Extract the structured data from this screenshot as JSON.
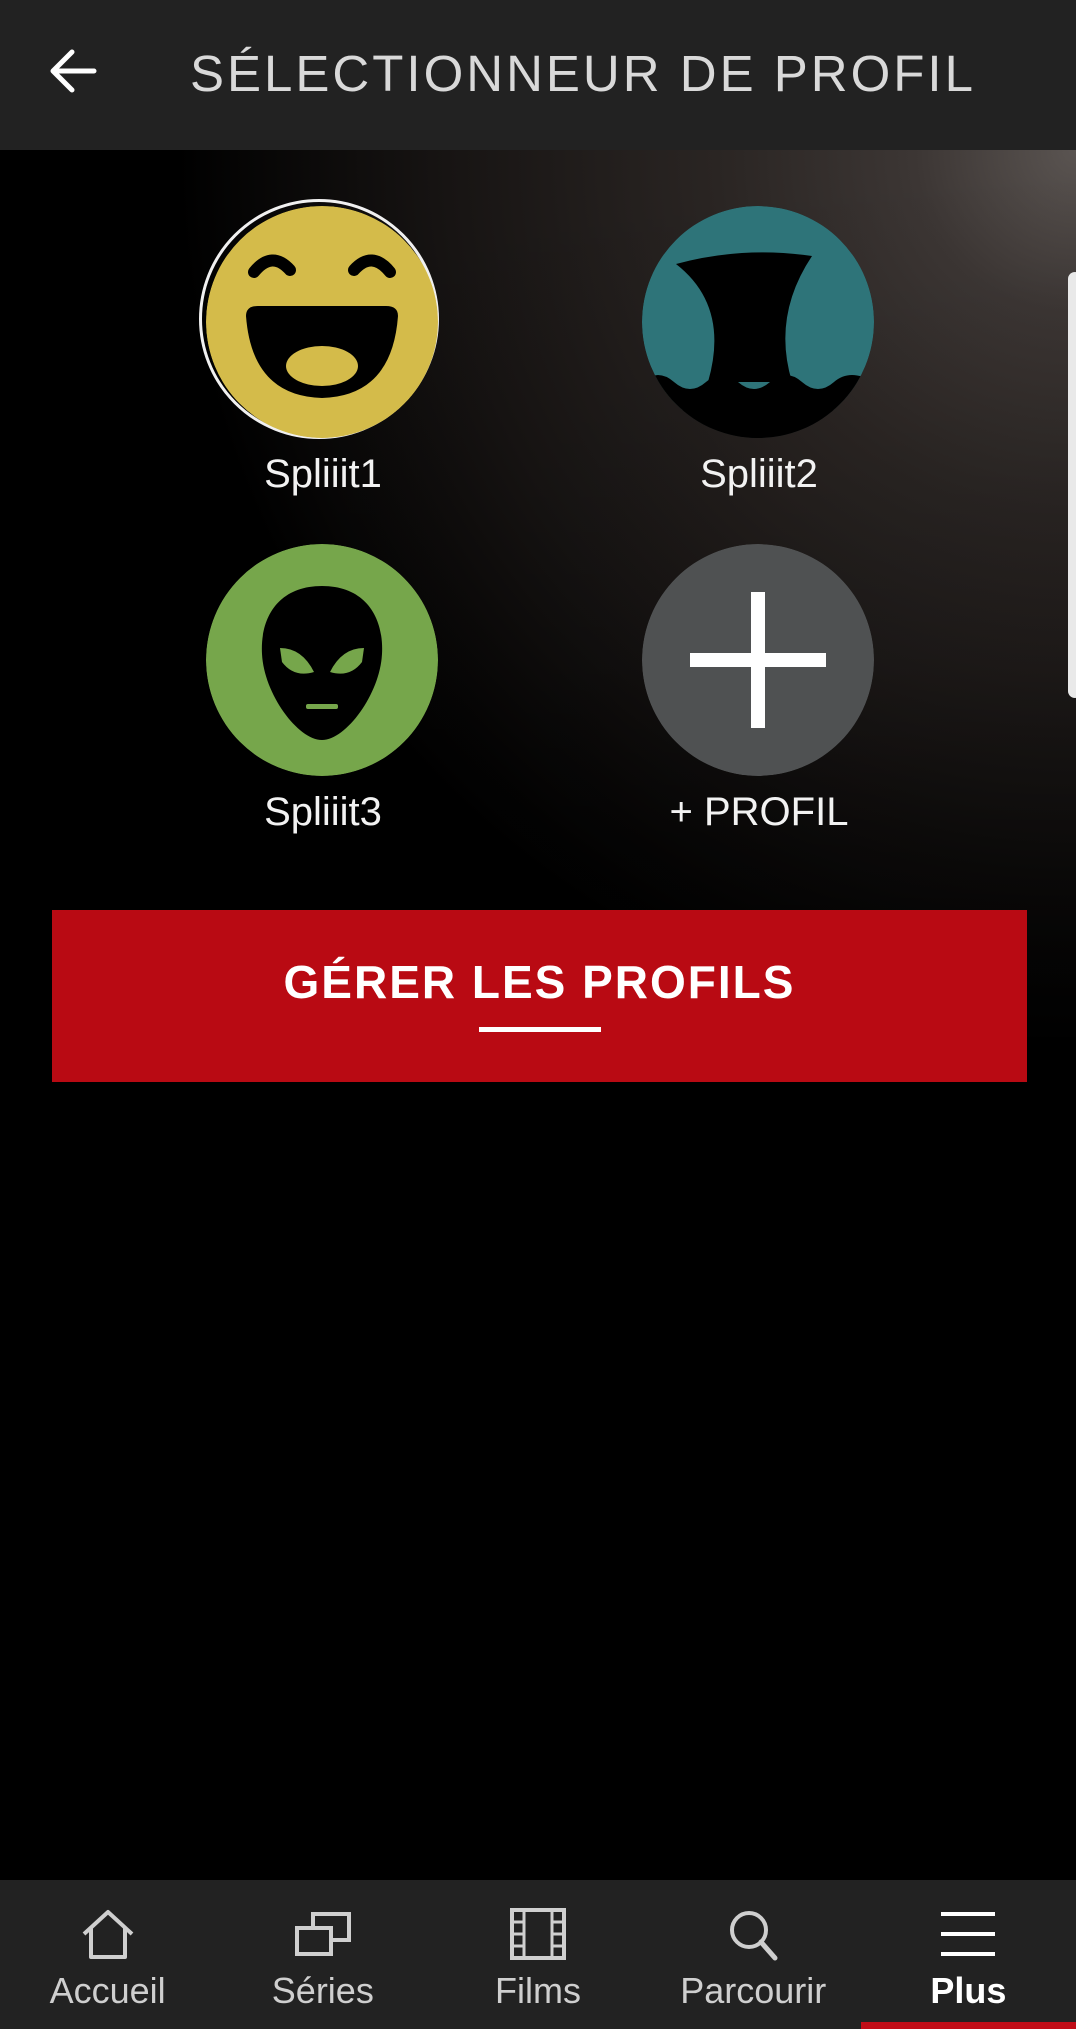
{
  "header": {
    "title": "SÉLECTIONNEUR DE PROFIL",
    "back_icon": "arrow-left-icon"
  },
  "profiles": [
    {
      "name": "Spliiit1",
      "icon": "laughing-face-icon",
      "color": "#d4bb4a",
      "selected": true
    },
    {
      "name": "Spliiit2",
      "icon": "shark-fin-icon",
      "color": "#2e7479",
      "selected": false
    },
    {
      "name": "Spliiit3",
      "icon": "alien-icon",
      "color": "#76a64b",
      "selected": false
    }
  ],
  "add_profile": {
    "label": "+ PROFIL",
    "icon": "plus-icon",
    "color": "#4f5152"
  },
  "manage_button": {
    "label": "GÉRER LES PROFILS",
    "color": "#b90a13"
  },
  "tabbar": {
    "active_color": "#c00d17",
    "tabs": [
      {
        "label": "Accueil",
        "icon": "home-icon",
        "active": false
      },
      {
        "label": "Séries",
        "icon": "series-icon",
        "active": false
      },
      {
        "label": "Films",
        "icon": "film-icon",
        "active": false
      },
      {
        "label": "Parcourir",
        "icon": "search-icon",
        "active": false
      },
      {
        "label": "Plus",
        "icon": "menu-icon",
        "active": true
      }
    ]
  }
}
